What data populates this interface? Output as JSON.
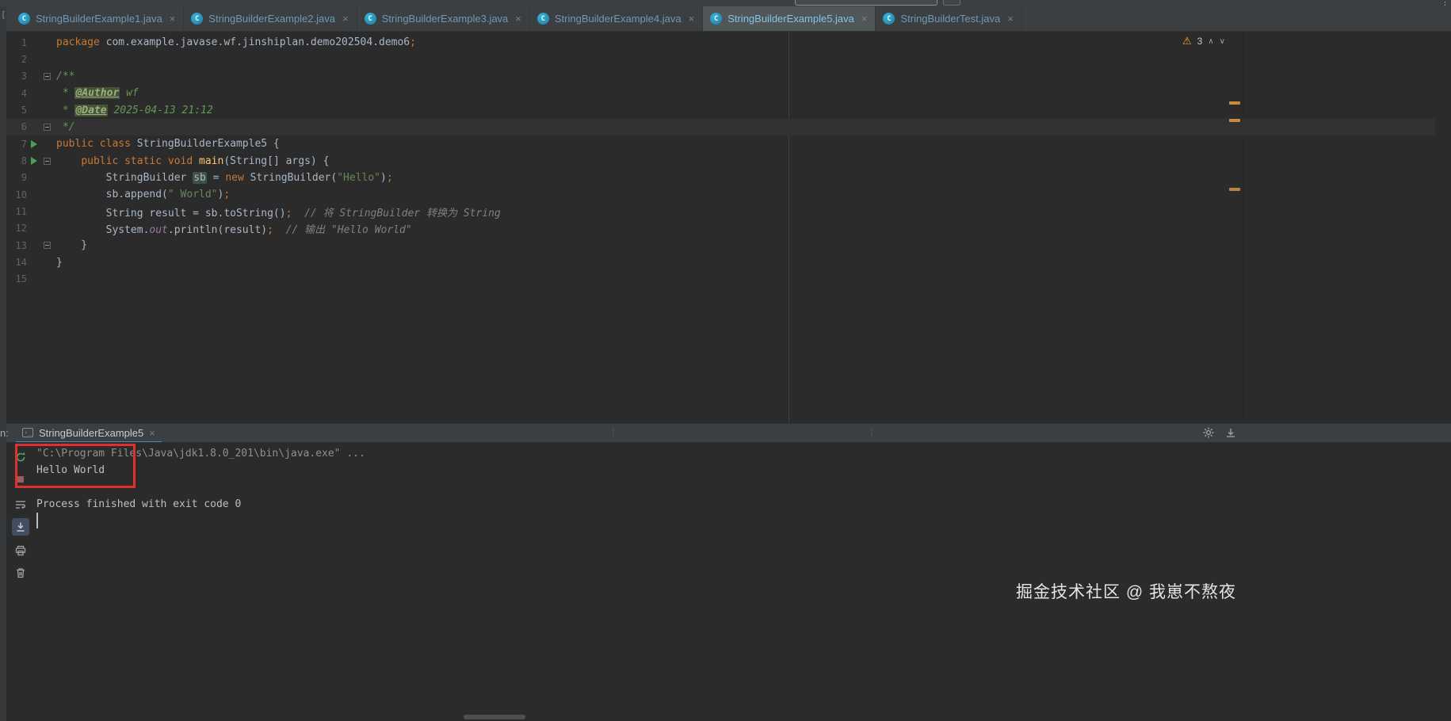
{
  "top": {
    "more_icon": "⋮"
  },
  "editor_tabs": {
    "active_index": 4,
    "icon_letter": "C",
    "close_glyph": "×",
    "items": [
      {
        "label": "StringBuilderExample1.java"
      },
      {
        "label": "StringBuilderExample2.java"
      },
      {
        "label": "StringBuilderExample3.java"
      },
      {
        "label": "StringBuilderExample4.java"
      },
      {
        "label": "StringBuilderExample5.java"
      },
      {
        "label": "StringBuilderTest.java"
      }
    ]
  },
  "inspections": {
    "warning_icon": "⚠",
    "warning_count": "3",
    "chevron_up": "∧",
    "chevron_down": "∨"
  },
  "code": {
    "line_numbers": [
      "1",
      "2",
      "3",
      "4",
      "5",
      "6",
      "7",
      "8",
      "9",
      "10",
      "11",
      "12",
      "13",
      "14",
      "15"
    ],
    "run_lines": [
      7,
      8
    ],
    "fold_lines": [
      3,
      6,
      8,
      13
    ],
    "caret_line": 6,
    "lines": [
      [
        [
          "k",
          "package"
        ],
        [
          "t",
          " com.example.javase.wf.jinshiplan.demo202504.demo6"
        ],
        [
          "k",
          ";"
        ]
      ],
      [],
      [
        [
          "d",
          "/**"
        ]
      ],
      [
        [
          "d",
          " * "
        ],
        [
          "g",
          "@Author"
        ],
        [
          "d",
          " wf"
        ]
      ],
      [
        [
          "d",
          " * "
        ],
        [
          "g",
          "@Date"
        ],
        [
          "d",
          " 2025-04-13 21:12"
        ]
      ],
      [
        [
          "d",
          " */"
        ]
      ],
      [
        [
          "k",
          "public class"
        ],
        [
          "t",
          " StringBuilderExample5 {"
        ]
      ],
      [
        [
          "t",
          "    "
        ],
        [
          "k",
          "public static void"
        ],
        [
          "t",
          " "
        ],
        [
          "m",
          "main"
        ],
        [
          "t",
          "(String[] args) {"
        ]
      ],
      [
        [
          "t",
          "        StringBuilder "
        ],
        [
          "h",
          "sb"
        ],
        [
          "t",
          " = "
        ],
        [
          "k",
          "new"
        ],
        [
          "t",
          " StringBuilder("
        ],
        [
          "s",
          "\"Hello\""
        ],
        [
          "t",
          ")"
        ],
        [
          "k",
          ";"
        ]
      ],
      [
        [
          "t",
          "        sb.append("
        ],
        [
          "s",
          "\" World\""
        ],
        [
          "t",
          ")"
        ],
        [
          "k",
          ";"
        ]
      ],
      [
        [
          "t",
          "        String result = sb.toString()"
        ],
        [
          "k",
          ";"
        ],
        [
          "c",
          "  // 将 StringBuilder 转换为 String"
        ]
      ],
      [
        [
          "t",
          "        System."
        ],
        [
          "f",
          "out"
        ],
        [
          "t",
          ".println(result)"
        ],
        [
          "k",
          ";"
        ],
        [
          "c",
          "  // 输出 \"Hello World\""
        ]
      ],
      [
        [
          "t",
          "    }"
        ]
      ],
      [
        [
          "t",
          "}"
        ]
      ],
      []
    ]
  },
  "run_panel": {
    "header_cut_label": "n:",
    "tab_label": "StringBuilderExample5",
    "close_glyph": "×",
    "tab_icon_glyph": "›_"
  },
  "console": {
    "lines": [
      {
        "cls": "dim",
        "text": "\"C:\\Program Files\\Java\\jdk1.8.0_201\\bin\\java.exe\" ..."
      },
      {
        "cls": "out",
        "text": "Hello World"
      },
      {
        "cls": "out",
        "text": ""
      },
      {
        "cls": "out",
        "text": "Process finished with exit code 0"
      }
    ]
  },
  "watermark": "掘金技术社区 @ 我崽不熬夜",
  "colors": {
    "annotation_red": "#e03131",
    "tab_underline_blue": "#4a88c7",
    "warning_yellow": "#f0a732",
    "stripe_mark_orange": "#c98a3d"
  }
}
